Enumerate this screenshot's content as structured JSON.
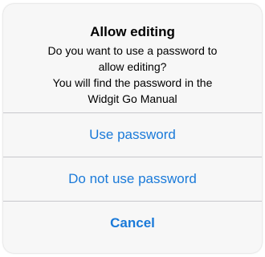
{
  "alert": {
    "title": "Allow editing",
    "message_lines": [
      "Do you want to use a password to",
      "allow editing?",
      "You will find the password in the",
      "Widgit Go Manual"
    ],
    "buttons": [
      {
        "label": "Use password"
      },
      {
        "label": "Do not use password"
      },
      {
        "label": "Cancel"
      }
    ]
  },
  "colors": {
    "accent": "#1a7ad9",
    "alert_background": "#f7f7f7",
    "divider": "#c8c8cc"
  }
}
